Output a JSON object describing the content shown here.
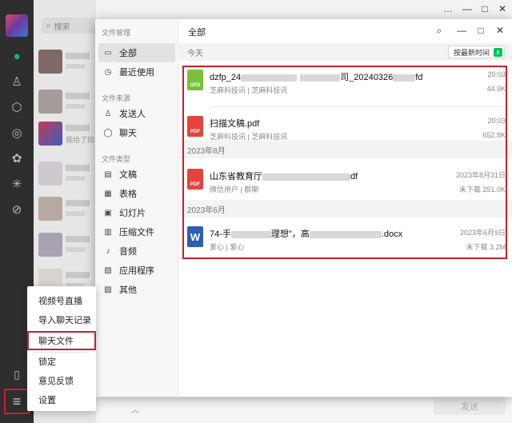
{
  "background": {
    "search_placeholder": "搜索",
    "chat_hint": "我给了拍自",
    "send_label": "发送",
    "win_controls": [
      "…",
      "—",
      "□",
      "✕"
    ]
  },
  "file_manager": {
    "side_title": "文件管理",
    "nav_top": [
      {
        "label": "全部",
        "icon": "folder-icon",
        "active": true
      },
      {
        "label": "最近使用",
        "icon": "clock-icon",
        "active": false
      }
    ],
    "source_title": "文件来源",
    "nav_source": [
      {
        "label": "发送人",
        "icon": "person-icon"
      },
      {
        "label": "聊天",
        "icon": "chat-bubble-icon"
      }
    ],
    "type_title": "文件类型",
    "nav_types": [
      {
        "label": "文稿",
        "icon": "document-icon"
      },
      {
        "label": "表格",
        "icon": "table-icon"
      },
      {
        "label": "幻灯片",
        "icon": "slides-icon"
      },
      {
        "label": "压缩文件",
        "icon": "archive-icon"
      },
      {
        "label": "音频",
        "icon": "audio-icon"
      },
      {
        "label": "应用程序",
        "icon": "app-icon"
      },
      {
        "label": "其他",
        "icon": "other-icon"
      }
    ],
    "title": "全部",
    "sort_label": "按最新时间",
    "sections": [
      {
        "label": "今天",
        "files": [
          {
            "icon": "ofd",
            "name_start": "dzfp_24",
            "name_end": "司_20240326",
            "name_tail": "fd",
            "source": "芝麻科技讯 | 芝麻科技讯",
            "date": "20:03",
            "size": "44.9K"
          },
          {
            "icon": "pdf",
            "name_start": "扫描文稿.pdf",
            "name_end": "",
            "name_tail": "",
            "source": "芝麻科技讯 | 芝麻科技讯",
            "date": "20:03",
            "size": "652.8K"
          }
        ]
      },
      {
        "label": "2023年8月",
        "files": [
          {
            "icon": "pdf",
            "name_start": "山东省教育厅",
            "name_end": "",
            "name_tail": "df",
            "source": "微信用户 | 群聊",
            "date": "2023年8月31日",
            "size": "未下载  251.0K"
          }
        ]
      },
      {
        "label": "2023年6月",
        "files": [
          {
            "icon": "doc",
            "name_start": "74-手",
            "name_end": "理想\"，高",
            "name_tail": ".docx",
            "source": "爱心 | 爱心",
            "date": "2023年6月9日",
            "size": "未下载  3.2M"
          }
        ]
      }
    ]
  },
  "popup_menu": {
    "items": [
      "视频号直播",
      "导入聊天记录",
      "聊天文件",
      "锁定",
      "意见反馈",
      "设置"
    ],
    "highlighted": "聊天文件"
  },
  "colors": {
    "highlight": "#c8202b",
    "wechat_green": "#07c160",
    "ofd": "#7cbf3c",
    "pdf": "#e4443c",
    "docx": "#2b5fb4"
  }
}
